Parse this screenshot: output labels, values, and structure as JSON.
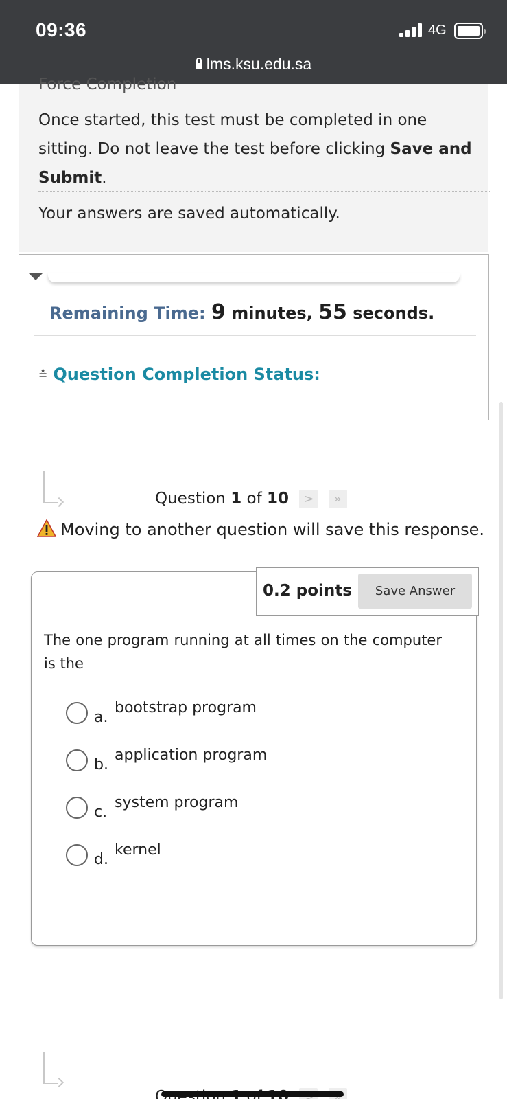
{
  "status_bar": {
    "time": "09:36",
    "network": "4G",
    "url": "lms.ksu.edu.sa"
  },
  "instructions": {
    "title": "Force Completion",
    "text_1": "Once started, this test must be completed in one sitting. Do not leave the test before clicking ",
    "text_bold": "Save and Submit",
    "text_end": ".",
    "autosave": "Your answers are saved automatically."
  },
  "timer": {
    "label": "Remaining Time:",
    "minutes": "9",
    "minutes_unit": "minutes,",
    "seconds": "55",
    "seconds_unit": "seconds."
  },
  "completion_status": {
    "label": "Question Completion Status:"
  },
  "question_nav": {
    "prefix": "Question",
    "current": "1",
    "of": "of",
    "total": "10",
    "next_glyph": ">",
    "last_glyph": "»"
  },
  "warning": {
    "text": "Moving to another question will save this response."
  },
  "question": {
    "points": "0.2 points",
    "save_label": "Save Answer",
    "text": "The one program running at all times on the computer is the",
    "options": [
      {
        "letter": "a.",
        "text": "bootstrap program"
      },
      {
        "letter": "b.",
        "text": "application program"
      },
      {
        "letter": "c.",
        "text": "system program"
      },
      {
        "letter": "d.",
        "text": "kernel"
      }
    ]
  }
}
